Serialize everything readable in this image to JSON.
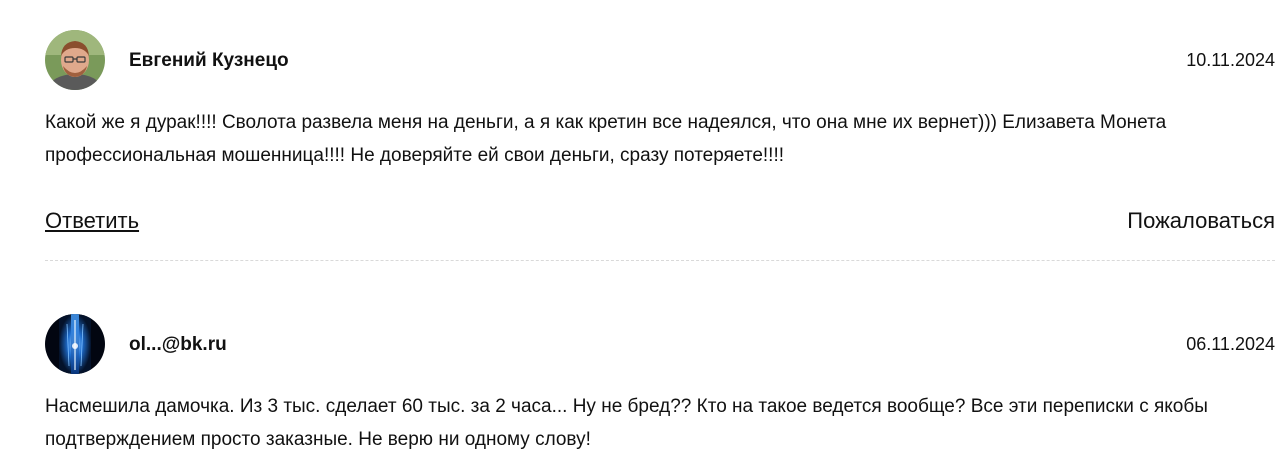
{
  "comments": [
    {
      "author": "Евгений Кузнецо",
      "date": "10.11.2024",
      "text": "Какой же я дурак!!!! Сволота развела меня на деньги, а я как кретин все надеялся, что она мне их вернет))) Елизавета Монета профессиональная мошенница!!!! Не доверяйте ей свои деньги, сразу потеряете!!!!",
      "reply_label": "Ответить",
      "complain_label": "Пожаловаться",
      "avatar": "person-photo"
    },
    {
      "author": "ol...@bk.ru",
      "date": "06.11.2024",
      "text": "Насмешила дамочка. Из 3 тыс. сделает 60 тыс. за 2 часа... Ну не бред?? Кто на такое ведется вообще? Все эти переписки с якобы подтверждением просто заказные. Не верю ни одному слову!",
      "avatar": "blue-light-image"
    }
  ],
  "colors": {
    "text": "#111111",
    "divider": "#d9d9d9",
    "background": "#ffffff"
  }
}
